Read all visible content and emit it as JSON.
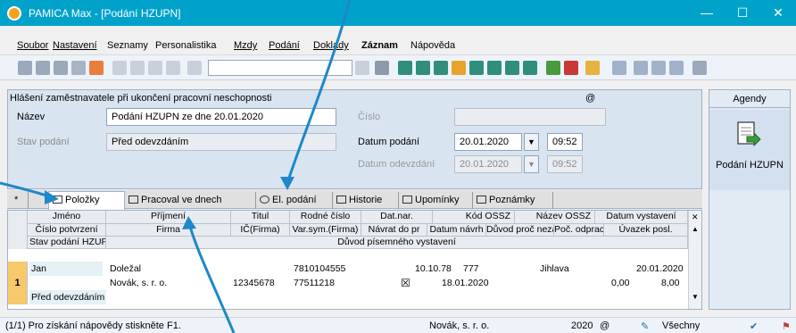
{
  "window": {
    "title": "PAMICA Max - [Podání HZUPN]",
    "minimize": "—",
    "maximize": "☐",
    "close": "✕"
  },
  "menu": [
    "Soubor",
    "Nastavení",
    "Seznamy",
    "Personalistika",
    "Mzdy",
    "Podání",
    "Doklady",
    "Záznam",
    "Nápověda"
  ],
  "form": {
    "header": "Hlášení zaměstnavatele při ukončení pracovní neschopnosti",
    "at_symbol": "@",
    "name_label": "Název",
    "name_value": "Podání HZUPN ze dne 20.01.2020",
    "number_label": "Číslo",
    "number_value": "",
    "state_label": "Stav podání",
    "state_value": "Před odevzdáním",
    "date_label": "Datum podání",
    "date_value": "20.01.2020",
    "time_value": "09:52",
    "handover_label": "Datum odevzdání",
    "handover_date": "20.01.2020",
    "handover_time": "09:52"
  },
  "agendy": {
    "header": "Agendy",
    "item": "Podání HZUPN"
  },
  "tabs": {
    "star": "*",
    "items": [
      "Položky",
      "Pracoval ve dnech",
      "El. podání",
      "Historie",
      "Upomínky",
      "Poznámky"
    ]
  },
  "grid": {
    "header1": [
      "Jméno",
      "Příjmení",
      "Titul",
      "Rodné číslo",
      "Dat.nar.",
      "Kód OSSZ",
      "Název OSSZ",
      "Datum vystavení"
    ],
    "header2": [
      "Číslo potvrzení",
      "Firma",
      "IČ(Firma)",
      "Var.sym.(Firma)",
      "Návrat do pr",
      "Datum návrh",
      "Důvod proč nezač",
      "Poč. odprac",
      "Úvazek posl."
    ],
    "header3": [
      "Stav podání HZUPN",
      "Důvod písemného vystavení"
    ],
    "row_number": "1",
    "row1": {
      "jmeno": "Jan",
      "prijmeni": "Doležal",
      "rodne_cislo": "7810104555",
      "dat_nar": "10.10.78",
      "kod_ossz": "777",
      "nazev_ossz": "Jihlava",
      "datum_vystaveni": "20.01.2020"
    },
    "row2": {
      "firma": "Novák, s. r. o.",
      "ic": "12345678",
      "var_sym": "77511218",
      "navrat_checkbox": "☒",
      "datum_navrh": "18.01.2020",
      "poc_odprac": "0,00",
      "uvazek": "8,00"
    },
    "row3": {
      "stav": "Před odevzdáním"
    }
  },
  "status": {
    "hint": "(1/1) Pro získání nápovědy stiskněte F1.",
    "company": "Novák, s. r. o.",
    "year": "2020",
    "at": "@",
    "filter": "Všechny"
  },
  "colors": {
    "titlebar": "#00a2ca",
    "highlight": "#f7c96a",
    "form_bg": "#d9e4f1",
    "arrow": "#1e88c8"
  }
}
